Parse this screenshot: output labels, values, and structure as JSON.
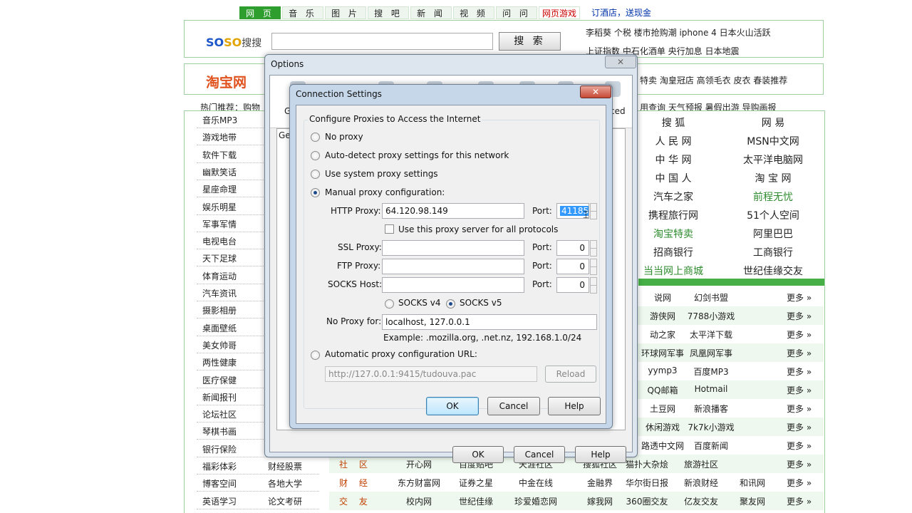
{
  "bg": {
    "nav_tabs": [
      "网 页",
      "音 乐",
      "图 片",
      "搜 吧",
      "新 闻",
      "视 频",
      "问 问",
      "网页游戏"
    ],
    "promo": "订酒店，送现金",
    "soso_logo": {
      "a": "SO",
      "b": "SO",
      "c": "搜搜"
    },
    "search_button": "搜 索",
    "hot_links_1": "李稻葵 个税 楼市抢购潮 iphone 4 日本火山活跃",
    "hot_links_2": "上证指数 中石化酒单 央行加息 日本地震",
    "hot_links_3": "特卖 淘皇冠店 高领毛衣 皮衣 春装推荐",
    "taobao_logo": "淘宝网",
    "hot_title": "热门推荐：购物",
    "hot_links_4": "用查询 天气预报 暑假出游 导购画报",
    "left_categories": [
      "音乐MP3",
      "游戏地带",
      "软件下载",
      "幽默笑话",
      "星座命理",
      "娱乐明星",
      "军事军情",
      "电视电台",
      "天下足球",
      "体育运动",
      "汽车资讯",
      "摄影相册",
      "桌面壁纸",
      "美女帅哥",
      "两性健康",
      "医疗保健",
      "新闻报刊",
      "论坛社区",
      "琴棋书画",
      "银行保险",
      "福彩体彩",
      "博客空间",
      "英语学习"
    ],
    "left_col2": [
      "财经股票",
      "各地大学",
      "论文考研"
    ],
    "sites": [
      [
        "搜 狐",
        "网 易"
      ],
      [
        "人 民 网",
        "MSN中文网"
      ],
      [
        "中 华 网",
        "太平洋电脑网"
      ],
      [
        "中 国 人",
        "淘 宝 网"
      ],
      [
        "汽车之家",
        "前程无忧"
      ],
      [
        "携程旅行网",
        "51个人空间"
      ],
      [
        "淘宝特卖",
        "阿里巴巴"
      ],
      [
        "招商银行",
        "工商银行"
      ],
      [
        "当当网上商城",
        "世纪佳缘交友"
      ]
    ],
    "rows": [
      {
        "label": "",
        "cells": [
          "说网",
          "幻剑书盟"
        ],
        "more": "更多 »"
      },
      {
        "label": "",
        "cells": [
          "游侠网",
          "7788小游戏"
        ],
        "more": "更多 »"
      },
      {
        "label": "",
        "cells": [
          "动之家",
          "太平洋下载"
        ],
        "more": "更多 »"
      },
      {
        "label": "",
        "cells": [
          "环球网军事",
          "凤凰网军事"
        ],
        "more": "更多 »"
      },
      {
        "label": "",
        "cells": [
          "yymp3",
          "百度MP3"
        ],
        "more": "更多 »"
      },
      {
        "label": "",
        "cells": [
          "QQ邮箱",
          "Hotmail"
        ],
        "more": "更多 »"
      },
      {
        "label": "",
        "cells": [
          "土豆网",
          "新浪播客"
        ],
        "more": "更多 »"
      },
      {
        "label": "",
        "cells": [
          "休闲游戏",
          "7k7k小游戏"
        ],
        "more": "更多 »"
      },
      {
        "label": "",
        "cells": [
          "路透中文网",
          "百度新闻"
        ],
        "more": "更多 »"
      },
      {
        "label": "社 区",
        "cells": [
          "开心网",
          "百度贴吧",
          "天涯社区",
          "搜狐社区",
          "猫扑大杂烩",
          "旅游社区"
        ],
        "more": "更多 »"
      },
      {
        "label": "财 经",
        "cells": [
          "东方财富网",
          "证券之星",
          "中金在线",
          "金融界",
          "华尔街日报",
          "新浪财经",
          "和讯网"
        ],
        "more": "更多 »"
      },
      {
        "label": "交 友",
        "cells": [
          "校内网",
          "世纪佳缘",
          "珍爱婚恋网",
          "嫁我网",
          "360圈交友",
          "亿友交友",
          "聚友网"
        ],
        "more": "更多 »"
      }
    ]
  },
  "options": {
    "title": "Options",
    "close": "✕",
    "tab_general_fragment": "G",
    "tab_advanced_fragment": "ced",
    "panel_label_fragment": "Ge",
    "ok": "OK",
    "cancel": "Cancel",
    "help": "Help"
  },
  "conn": {
    "title": "Connection Settings",
    "close": "✕",
    "header": "Configure Proxies to Access the Internet",
    "no_proxy": "No proxy",
    "auto_detect": "Auto-detect proxy settings for this network",
    "use_system": "Use system proxy settings",
    "manual": "Manual proxy configuration:",
    "http_label": "HTTP Proxy:",
    "http_value": "64.120.98.149",
    "port_label": "Port:",
    "http_port": "41185",
    "use_all": "Use this proxy server for all protocols",
    "ssl_label": "SSL Proxy:",
    "ssl_value": "",
    "ssl_port": "0",
    "ftp_label": "FTP Proxy:",
    "ftp_value": "",
    "ftp_port": "0",
    "socks_label": "SOCKS Host:",
    "socks_value": "",
    "socks_port": "0",
    "socks_v4": "SOCKS v4",
    "socks_v5": "SOCKS v5",
    "no_proxy_for_label": "No Proxy for:",
    "no_proxy_for_value": "localhost, 127.0.0.1",
    "example": "Example: .mozilla.org, .net.nz, 192.168.1.0/24",
    "auto_url": "Automatic proxy configuration URL:",
    "auto_url_value": "http://127.0.0.1:9415/tudouva.pac",
    "reload": "Reload",
    "ok": "OK",
    "cancel": "Cancel",
    "help": "Help"
  },
  "colors": {
    "accent_green": "#2e9e2e",
    "close_red": "#c64a36",
    "selection": "#3399ff"
  }
}
